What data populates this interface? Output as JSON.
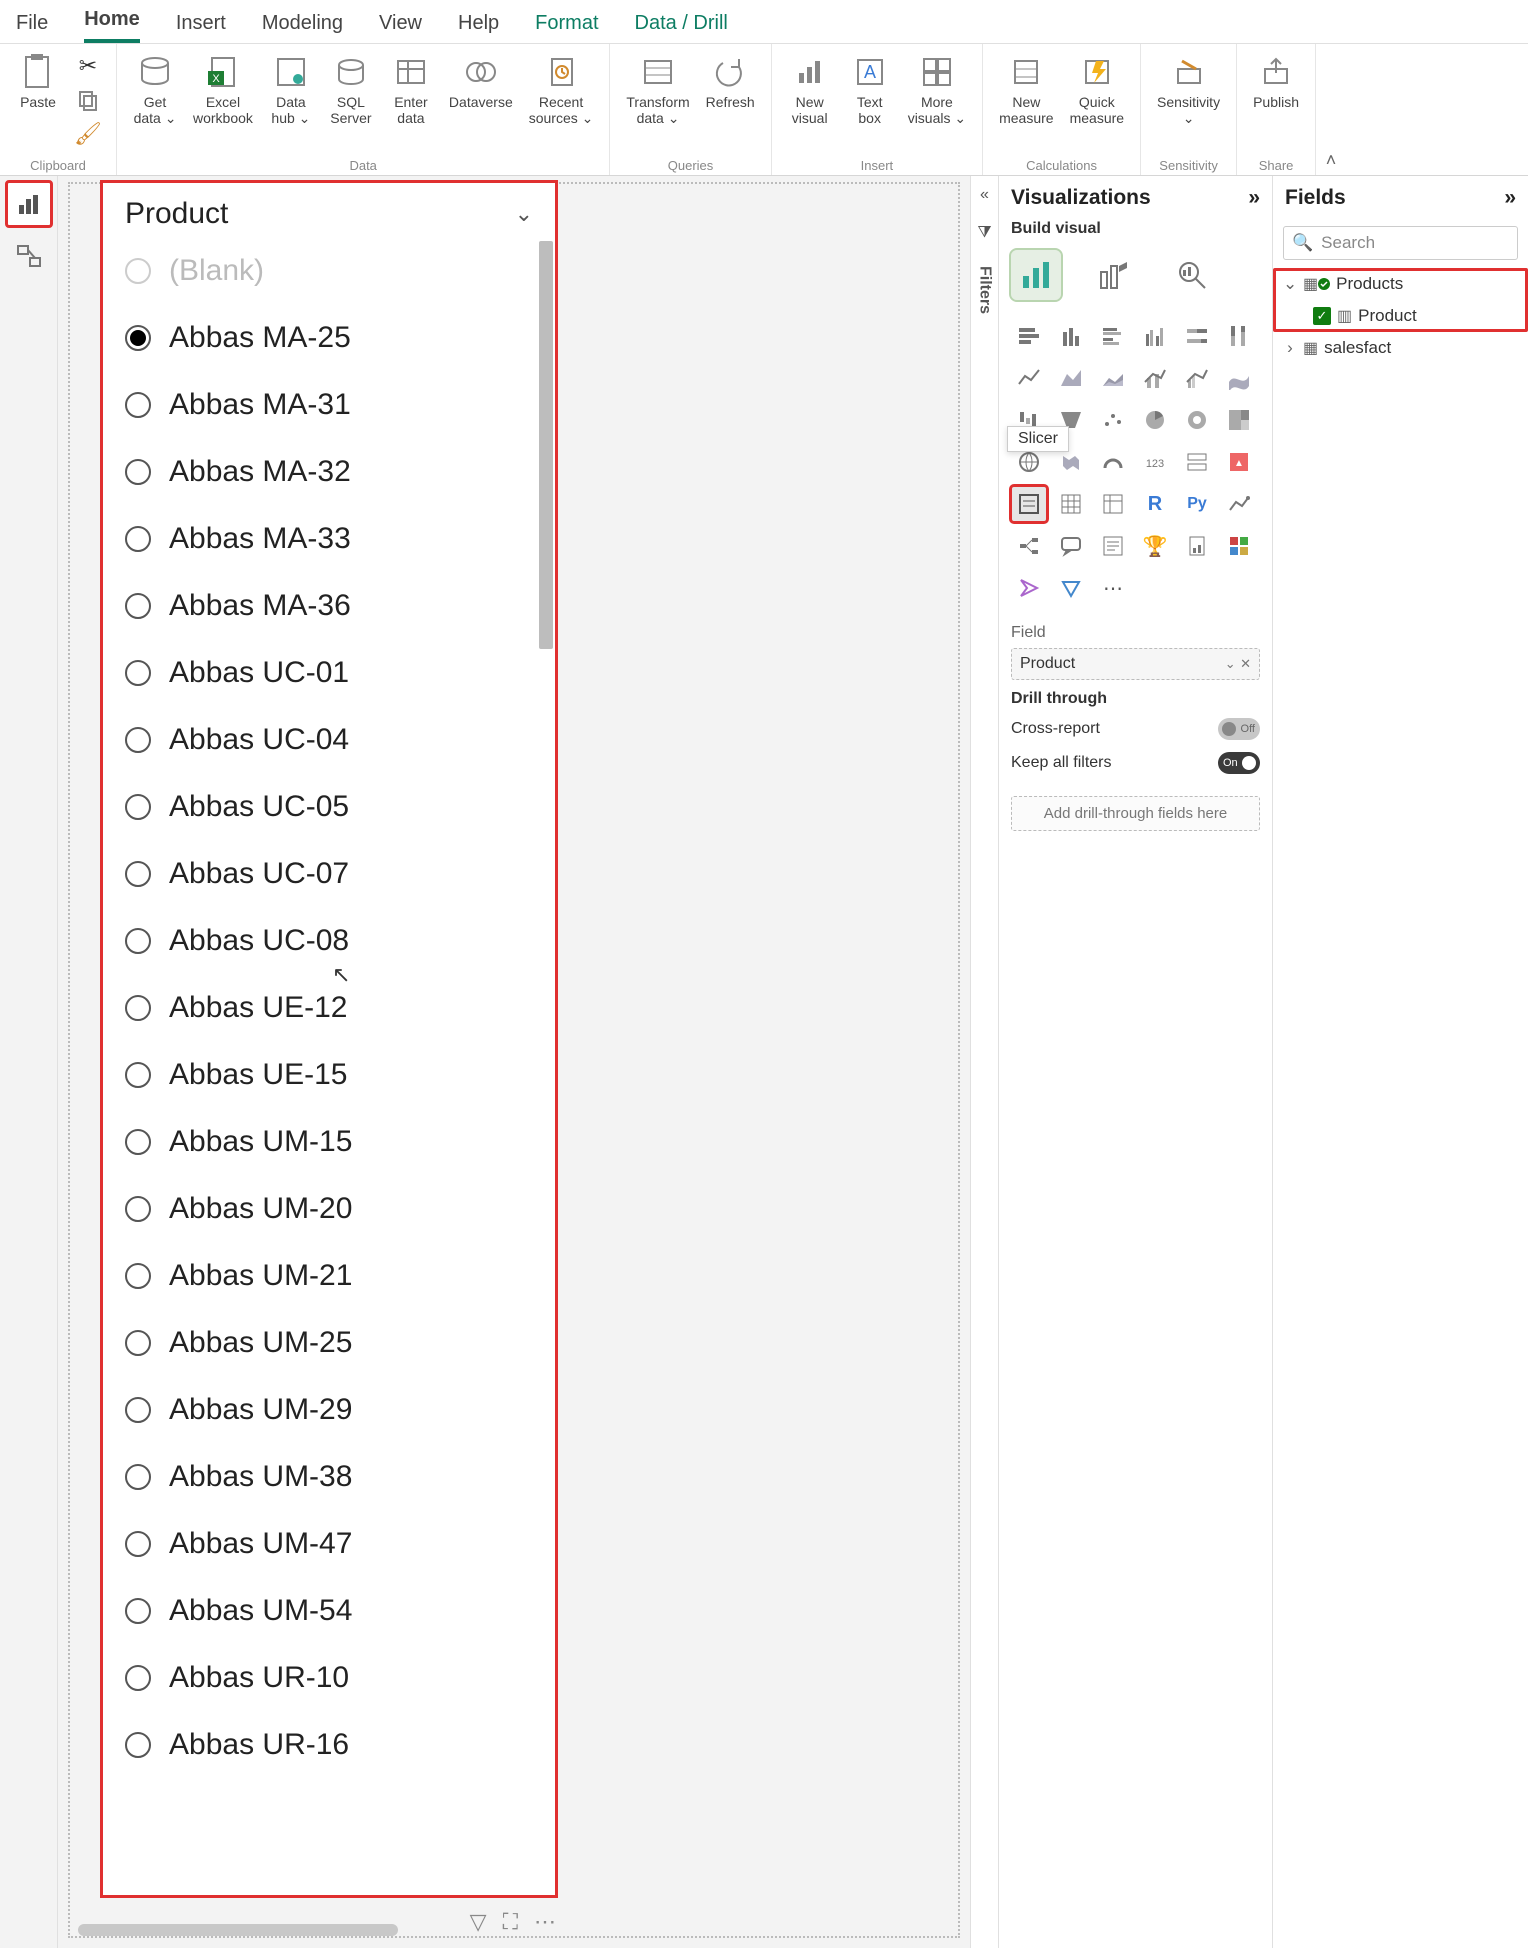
{
  "tabs": {
    "file": "File",
    "home": "Home",
    "insert": "Insert",
    "modeling": "Modeling",
    "view": "View",
    "help": "Help",
    "format": "Format",
    "data_drill": "Data / Drill"
  },
  "ribbon": {
    "groups": {
      "clipboard": "Clipboard",
      "data": "Data",
      "queries": "Queries",
      "insert": "Insert",
      "calculations": "Calculations",
      "sensitivity": "Sensitivity",
      "share": "Share"
    },
    "buttons": {
      "paste": "Paste",
      "get_data": "Get\ndata ⌄",
      "excel_workbook": "Excel\nworkbook",
      "data_hub": "Data\nhub ⌄",
      "sql_server": "SQL\nServer",
      "enter_data": "Enter\ndata",
      "dataverse": "Dataverse",
      "recent_sources": "Recent\nsources ⌄",
      "transform_data": "Transform\ndata ⌄",
      "refresh": "Refresh",
      "new_visual": "New\nvisual",
      "text_box": "Text\nbox",
      "more_visuals": "More\nvisuals ⌄",
      "new_measure": "New\nmeasure",
      "quick_measure": "Quick\nmeasure",
      "sensitivity": "Sensitivity\n⌄",
      "publish": "Publish"
    }
  },
  "slicer": {
    "title": "Product",
    "tooltip": "Slicer",
    "items": [
      {
        "label": "(Blank)",
        "selected": false,
        "blank": true
      },
      {
        "label": "Abbas MA-25",
        "selected": true
      },
      {
        "label": "Abbas MA-31",
        "selected": false
      },
      {
        "label": "Abbas MA-32",
        "selected": false
      },
      {
        "label": "Abbas MA-33",
        "selected": false
      },
      {
        "label": "Abbas MA-36",
        "selected": false
      },
      {
        "label": "Abbas UC-01",
        "selected": false
      },
      {
        "label": "Abbas UC-04",
        "selected": false
      },
      {
        "label": "Abbas UC-05",
        "selected": false
      },
      {
        "label": "Abbas UC-07",
        "selected": false
      },
      {
        "label": "Abbas UC-08",
        "selected": false
      },
      {
        "label": "Abbas UE-12",
        "selected": false
      },
      {
        "label": "Abbas UE-15",
        "selected": false
      },
      {
        "label": "Abbas UM-15",
        "selected": false
      },
      {
        "label": "Abbas UM-20",
        "selected": false
      },
      {
        "label": "Abbas UM-21",
        "selected": false
      },
      {
        "label": "Abbas UM-25",
        "selected": false
      },
      {
        "label": "Abbas UM-29",
        "selected": false
      },
      {
        "label": "Abbas UM-38",
        "selected": false
      },
      {
        "label": "Abbas UM-47",
        "selected": false
      },
      {
        "label": "Abbas UM-54",
        "selected": false
      },
      {
        "label": "Abbas UR-10",
        "selected": false
      },
      {
        "label": "Abbas UR-16",
        "selected": false
      }
    ]
  },
  "viz_panel": {
    "title": "Visualizations",
    "subtitle": "Build visual",
    "field_section": "Field",
    "field_value": "Product",
    "drill_title": "Drill through",
    "cross_report": "Cross-report",
    "cross_report_state": "Off",
    "keep_filters": "Keep all filters",
    "keep_filters_state": "On",
    "drill_placeholder": "Add drill-through fields here"
  },
  "fields_panel": {
    "title": "Fields",
    "search_placeholder": "Search",
    "tables": {
      "products": "Products",
      "product_col": "Product",
      "salesfact": "salesfact"
    }
  },
  "filters_label": "Filters"
}
